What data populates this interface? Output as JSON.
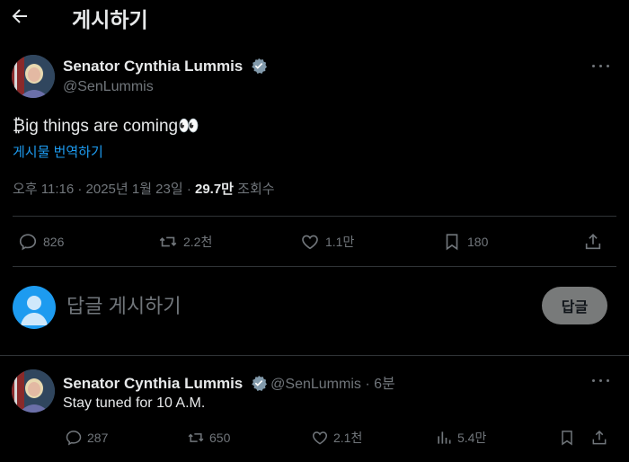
{
  "header": {
    "title": "게시하기"
  },
  "post": {
    "author_name": "Senator Cynthia Lummis",
    "author_handle": "@SenLummis",
    "text": "₿ig things are coming👀",
    "translate": "게시물 번역하기",
    "timestamp": "오후 11:16 · 2025년 1월 23일 · ",
    "views": "29.7만",
    "views_label": " 조회수",
    "actions": {
      "replies": "826",
      "reposts": "2.2천",
      "likes": "1.1만",
      "bookmarks": "180"
    }
  },
  "reply_box": {
    "placeholder": "답글 게시하기",
    "button": "답글"
  },
  "reply": {
    "author_name": "Senator Cynthia Lummis",
    "author_handle": "@SenLummis",
    "time": " · 6분",
    "text": "Stay tuned for 10 A.M.",
    "actions": {
      "replies": "287",
      "reposts": "650",
      "likes": "2.1천",
      "views": "5.4만"
    }
  },
  "colors": {
    "background": "#000000",
    "text": "#e7e9ea",
    "muted": "#71767b",
    "link": "#1d9bf0",
    "verified": "#829aab",
    "divider": "#2f3336"
  },
  "icons": [
    "back-arrow-icon",
    "verified-badge-icon",
    "more-icon",
    "reply-icon",
    "repost-icon",
    "like-icon",
    "bookmark-icon",
    "share-icon",
    "views-icon",
    "default-avatar-icon"
  ]
}
